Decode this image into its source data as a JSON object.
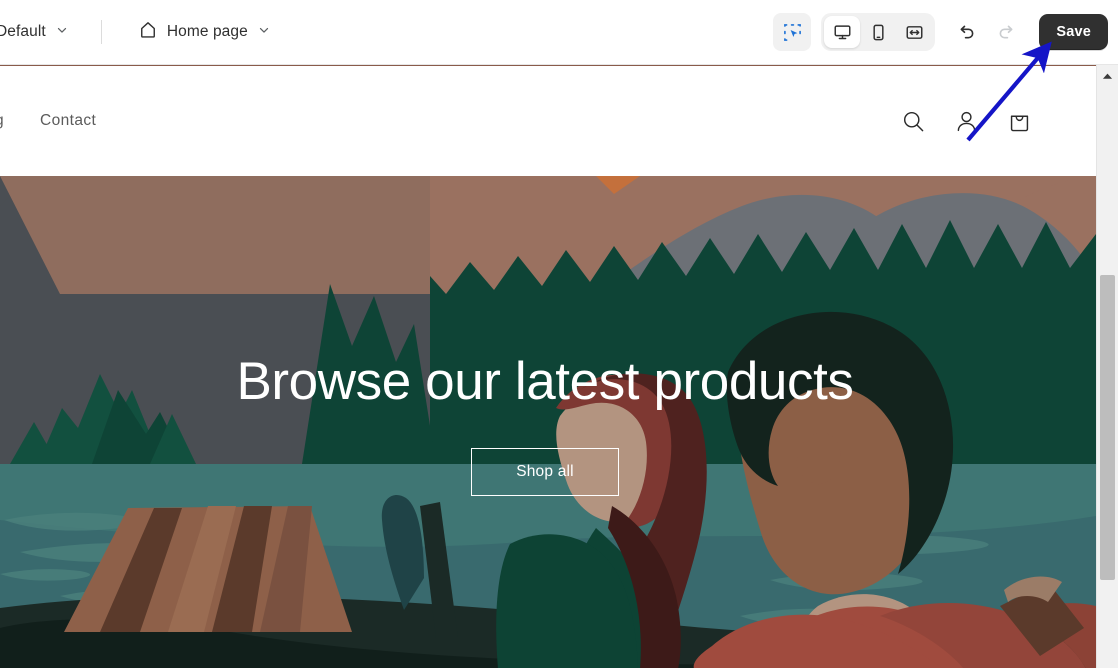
{
  "editor": {
    "theme_selector": {
      "label": "Default",
      "icon": "chevron-down-icon"
    },
    "page_selector": {
      "label": "Home page",
      "icon": "home-icon",
      "chevron": "chevron-down-icon"
    },
    "tools": {
      "inspect_label": "Select section",
      "desktop_label": "Desktop view",
      "mobile_label": "Mobile view",
      "fullwidth_label": "Full width view",
      "undo_label": "Undo",
      "redo_label": "Redo",
      "active_device": "desktop"
    },
    "save_label": "Save",
    "accent_color": "#303030",
    "annotation": {
      "type": "arrow",
      "color": "#1515c7",
      "points_to": "save-button"
    }
  },
  "store": {
    "nav": [
      {
        "label": "og"
      },
      {
        "label": "Contact"
      }
    ],
    "header_icons": [
      {
        "name": "search-icon"
      },
      {
        "name": "account-icon"
      },
      {
        "name": "cart-icon"
      }
    ],
    "hero": {
      "title": "Browse our latest products",
      "button_label": "Shop all",
      "colors": {
        "sky_gray": "#4a4e53",
        "mountain_brown_light": "#8f6d5e",
        "mountain_brown": "#9a7160",
        "mountain_gray": "#6c7076",
        "forest_green": "#0e4436",
        "tree_green": "#12503f",
        "water_teal": "#3f7674",
        "water_teal_dark": "#396a6e",
        "canoe_dark": "#111f1b",
        "shirt_rust": "#a04b3e",
        "shirt_green": "#0d4334",
        "hair_auburn": "#4f221f",
        "hair_dark": "#13231d",
        "skin_tan": "#b39480",
        "skin_brown": "#8c5f46",
        "luggage_brown": "#8e6049",
        "text_white": "#ffffff"
      }
    }
  },
  "scrollbar": {
    "up_arrow": "scroll-up-arrow",
    "thumb_position": "mid"
  }
}
